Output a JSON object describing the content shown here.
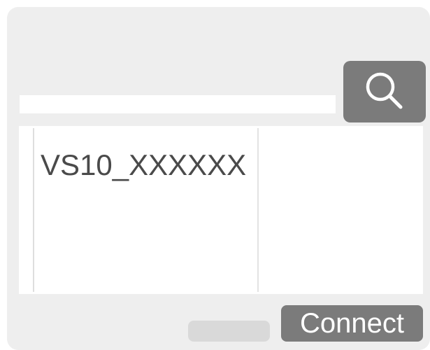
{
  "search": {
    "value": "",
    "placeholder": "",
    "button_icon": "search-icon"
  },
  "device_list": {
    "items": [
      {
        "label": "VS10_XXXXXX"
      }
    ]
  },
  "actions": {
    "connect_label": "Connect"
  },
  "colors": {
    "panel_bg": "#eeeeee",
    "button_bg": "#7b7b7b",
    "text": "#4a4a4a",
    "button_text": "#ffffff"
  }
}
